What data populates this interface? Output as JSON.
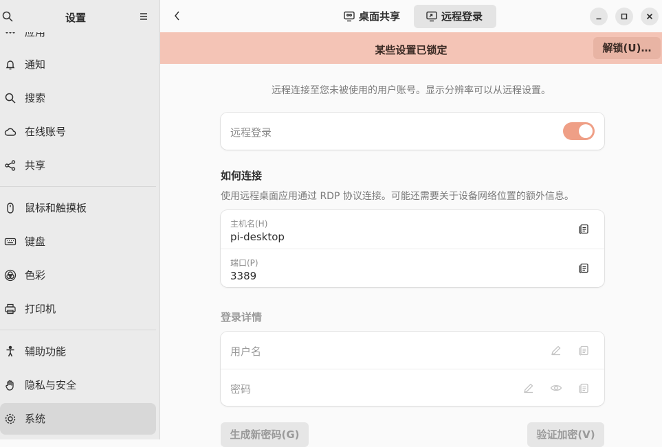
{
  "sidebar": {
    "title": "设置",
    "items": [
      {
        "label": "应用",
        "icon": "apps-icon",
        "active": false
      },
      {
        "label": "通知",
        "icon": "bell-icon",
        "active": false
      },
      {
        "label": "搜索",
        "icon": "search-icon",
        "active": false
      },
      {
        "label": "在线账号",
        "icon": "cloud-icon",
        "active": false
      },
      {
        "label": "共享",
        "icon": "share-icon",
        "active": false
      },
      {
        "label": "鼠标和触摸板",
        "icon": "mouse-icon",
        "active": false
      },
      {
        "label": "键盘",
        "icon": "keyboard-icon",
        "active": false
      },
      {
        "label": "色彩",
        "icon": "color-icon",
        "active": false
      },
      {
        "label": "打印机",
        "icon": "printer-icon",
        "active": false
      },
      {
        "label": "辅助功能",
        "icon": "accessibility-icon",
        "active": false
      },
      {
        "label": "隐私与安全",
        "icon": "hand-icon",
        "active": false
      },
      {
        "label": "系统",
        "icon": "gear-icon",
        "active": true
      }
    ]
  },
  "header": {
    "tabs": [
      {
        "label": "桌面共享",
        "icon": "desktop-share-icon",
        "active": false
      },
      {
        "label": "远程登录",
        "icon": "remote-login-icon",
        "active": true
      }
    ]
  },
  "banner": {
    "text": "某些设置已锁定",
    "unlock_label": "解锁(U)…"
  },
  "main": {
    "description": "远程连接至您未被使用的用户账号。显示分辨率可以从远程设置。",
    "remote_login": {
      "label": "远程登录",
      "enabled": true
    },
    "how_to_connect": {
      "title": "如何连接",
      "description": "使用远程桌面应用通过 RDP 协议连接。可能还需要关于设备网络位置的额外信息。",
      "hostname_label": "主机名(H)",
      "hostname_value": "pi-desktop",
      "port_label": "端口(P)",
      "port_value": "3389"
    },
    "login_details": {
      "title": "登录详情",
      "username_label": "用户名",
      "password_label": "密码"
    },
    "generate_password_label": "生成新密码(G)",
    "verify_encryption_label": "验证加密(V)"
  },
  "colors": {
    "accent": "#ef9f86",
    "banner": "#f4c4b6"
  }
}
